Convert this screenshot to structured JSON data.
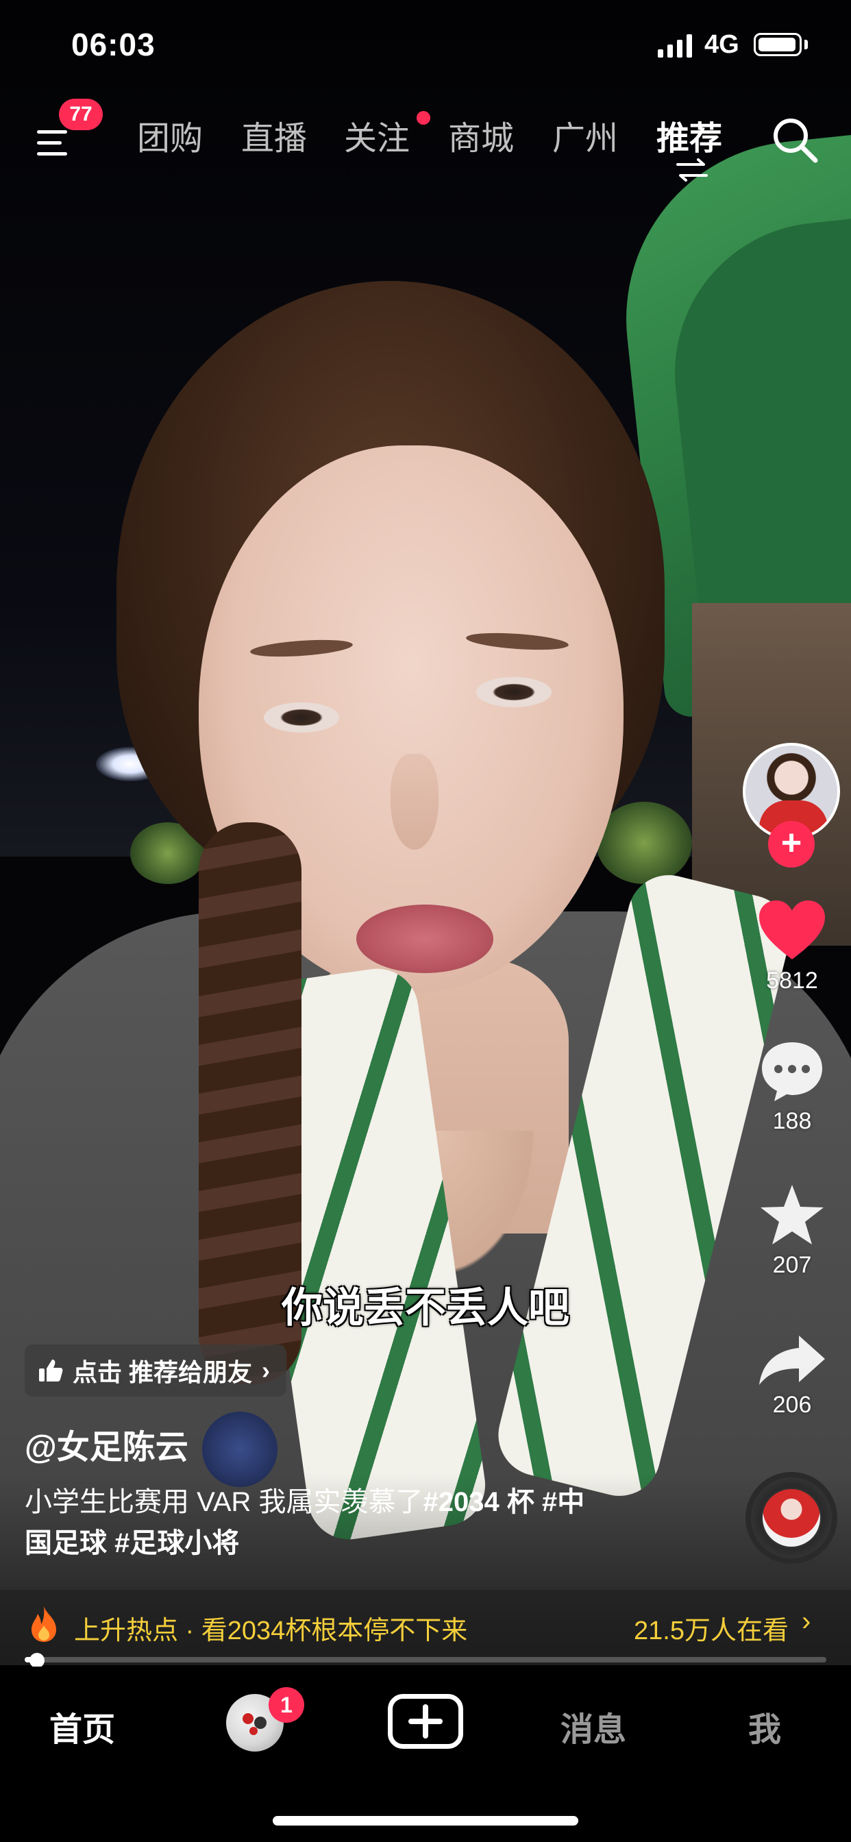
{
  "status_bar": {
    "time": "06:03",
    "network": "4G",
    "icons": [
      "signal-icon",
      "battery-icon"
    ]
  },
  "top_nav": {
    "menu_badge": "77",
    "tabs": [
      {
        "label": "团购",
        "active": false
      },
      {
        "label": "直播",
        "active": false
      },
      {
        "label": "关注",
        "active": false,
        "dot": true
      },
      {
        "label": "商城",
        "active": false
      },
      {
        "label": "广州",
        "active": false
      },
      {
        "label": "推荐",
        "active": true
      }
    ],
    "icons": [
      "menu-icon",
      "search-icon",
      "switch-icon"
    ]
  },
  "video": {
    "subtitle": "你说丢不丢人吧"
  },
  "actions": {
    "like_count": "5812",
    "comment_count": "188",
    "favorite_count": "207",
    "share_count": "206",
    "follow_symbol": "+"
  },
  "post": {
    "recommend_label": "点击 推荐给朋友",
    "author": "@女足陈云",
    "caption_line1": "小学生比赛用 VAR 我属实羡慕了",
    "hashtag1": "#2034 杯",
    "hashtag2_part1": "#中",
    "hashtag2_part2": "国足球",
    "hashtag3": "#足球小将"
  },
  "trend": {
    "text": "上升热点 · 看2034杯根本停不下来",
    "viewers": "21.5万人在看",
    "chevron": "›"
  },
  "playback": {
    "progress": 0.015
  },
  "tab_bar": {
    "home": "首页",
    "friends_badge": "1",
    "messages": "消息",
    "me": "我"
  },
  "colors": {
    "accent": "#fe2c55",
    "trend": "#f5cf3b",
    "background": "#000000"
  }
}
